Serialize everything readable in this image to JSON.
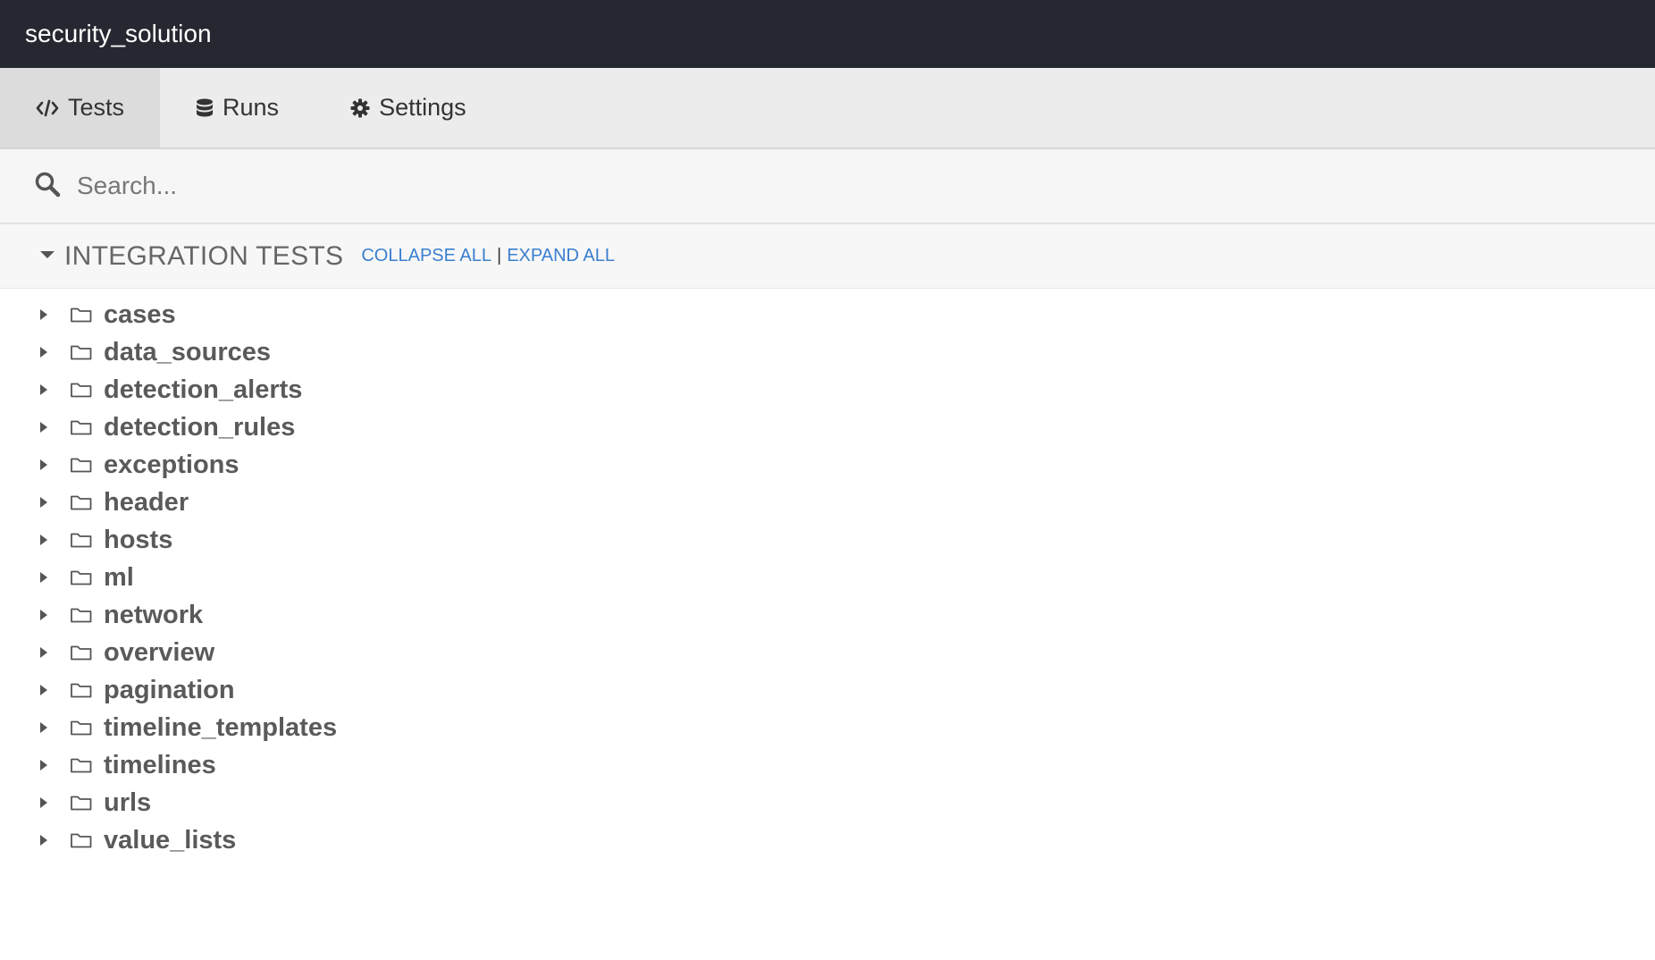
{
  "app": {
    "title": "security_solution"
  },
  "tabs": [
    {
      "label": "Tests",
      "icon": "code-icon",
      "active": true
    },
    {
      "label": "Runs",
      "icon": "database-icon",
      "active": false
    },
    {
      "label": "Settings",
      "icon": "gear-icon",
      "active": false
    }
  ],
  "search": {
    "placeholder": "Search...",
    "value": ""
  },
  "section": {
    "title": "INTEGRATION TESTS",
    "collapse_all": "COLLAPSE ALL",
    "separator": "|",
    "expand_all": "EXPAND ALL"
  },
  "folders": [
    "cases",
    "data_sources",
    "detection_alerts",
    "detection_rules",
    "exceptions",
    "header",
    "hosts",
    "ml",
    "network",
    "overview",
    "pagination",
    "timeline_templates",
    "timelines",
    "urls",
    "value_lists"
  ],
  "colors": {
    "topbar": "#252830",
    "link": "#3a7fd0",
    "tab_active": "#dcdcdc"
  }
}
